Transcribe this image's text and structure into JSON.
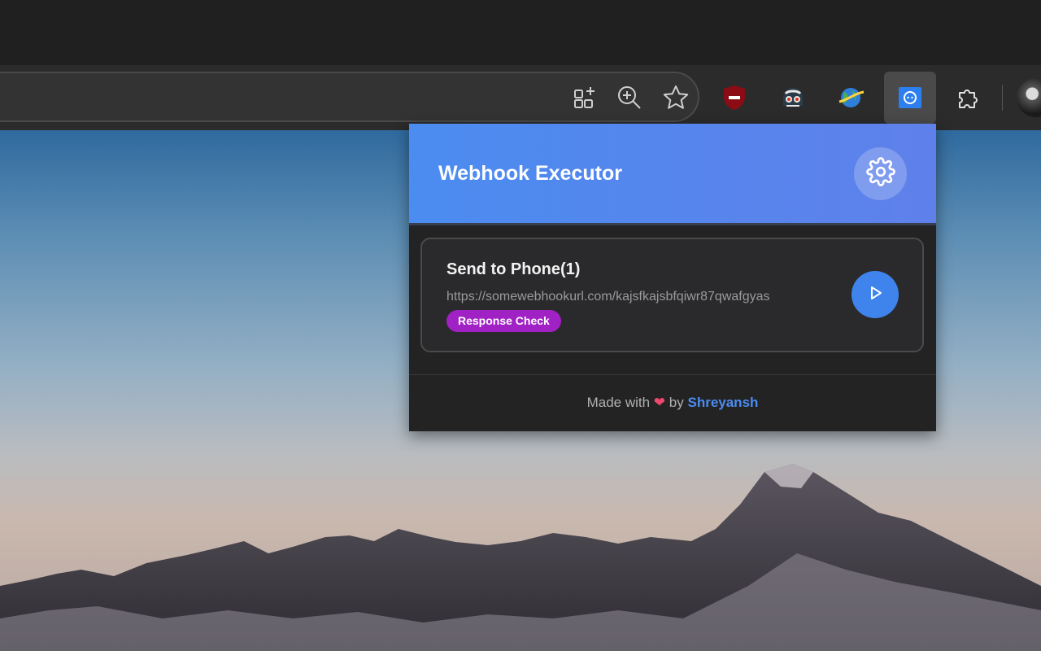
{
  "browser": {
    "toolbar_icons": [
      "apps-add-icon",
      "zoom-in-icon",
      "favorite-star-icon",
      "ublock-shield-icon",
      "privacy-badger-icon",
      "globe-extension-icon",
      "webhook-extension-icon",
      "extensions-puzzle-icon",
      "profile-avatar"
    ]
  },
  "popup": {
    "title": "Webhook Executor",
    "settings_icon": "gear-icon",
    "webhooks": [
      {
        "name": "Send to Phone(1)",
        "url": "https://somewebhookurl.com/kajsfkajsbfqiwr87qwafgyas",
        "tag": "Response Check",
        "action_icon": "play-icon"
      }
    ],
    "footer": {
      "prefix": "Made with",
      "heart": "❤",
      "by": "by",
      "author": "Shreyansh"
    }
  },
  "colors": {
    "header_start": "#4b8cf0",
    "header_end": "#5f80ea",
    "tag_bg": "#a021c4",
    "play_bg": "#3f84ec",
    "author": "#4b8cf0"
  }
}
